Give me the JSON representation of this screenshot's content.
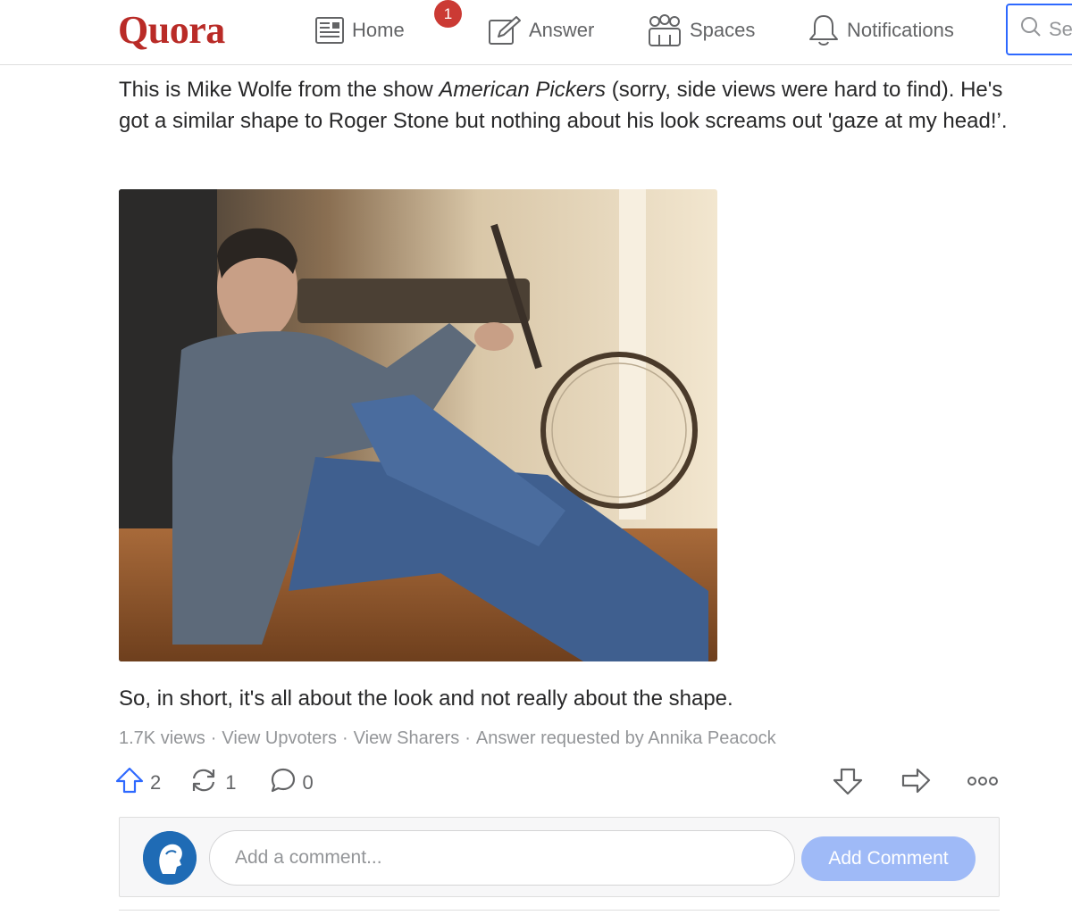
{
  "header": {
    "logo": "Quora",
    "nav": {
      "home": "Home",
      "answer": "Answer",
      "spaces": "Spaces",
      "notifications": "Notifications"
    },
    "badge_count": "1",
    "search_placeholder": "Se"
  },
  "answer": {
    "para1_before": "This is Mike Wolfe from the show ",
    "para1_italic": "American Pickers",
    "para1_after": " (sorry, side views were hard to find). He's got a similar shape to Roger Stone but nothing about his look screams out 'gaze at my head!’.",
    "para2": "So, in short, it's all about the look and not really about the shape.",
    "meta": {
      "views": "1.7K views",
      "sep": "·",
      "upvoters": "View Upvoters",
      "sharers": "View Sharers",
      "requested": "Answer requested by Annika Peacock"
    },
    "actions": {
      "upvotes": "2",
      "shares": "1",
      "comments": "0"
    }
  },
  "comment": {
    "placeholder": "Add a comment...",
    "button": "Add Comment"
  },
  "colors": {
    "brand": "#b92b27",
    "accent": "#2e69ff",
    "badge": "#cb3a34",
    "button_disabled": "#9fbaf7"
  },
  "icons": [
    "home-icon",
    "answer-icon",
    "spaces-icon",
    "bell-icon",
    "search-icon",
    "upvote-icon",
    "reshare-icon",
    "comment-icon",
    "downvote-icon",
    "share-icon",
    "more-icon"
  ]
}
